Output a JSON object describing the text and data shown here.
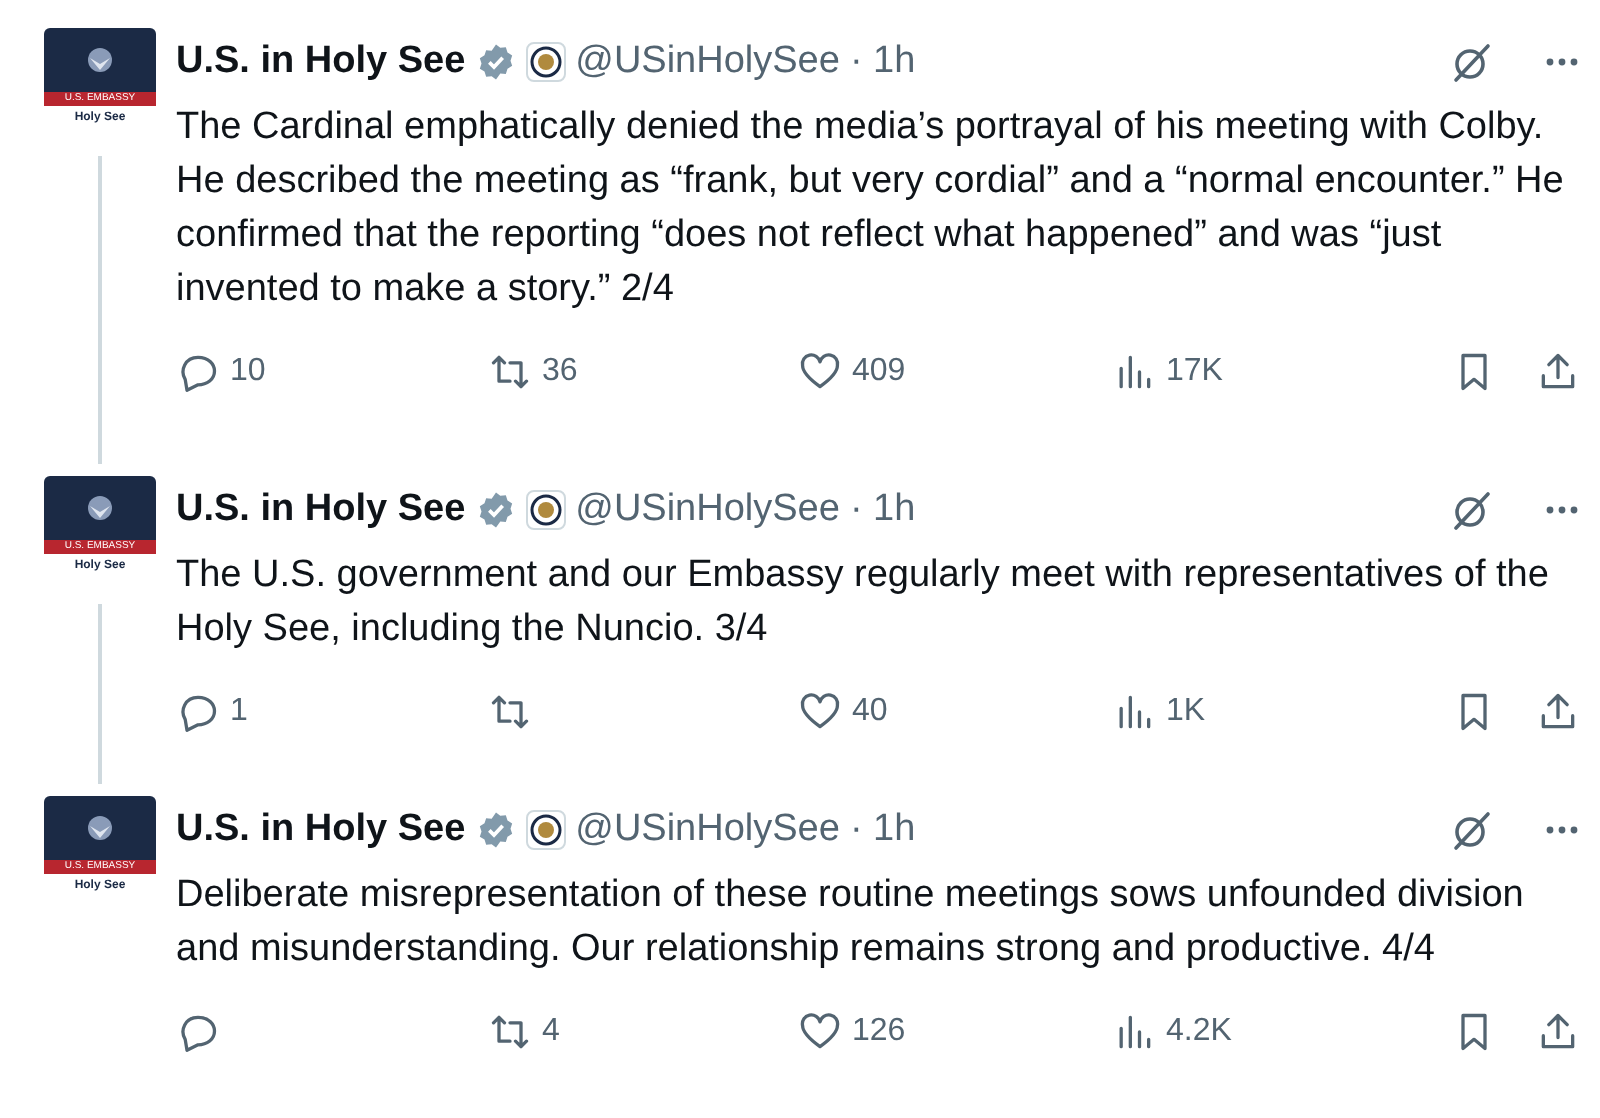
{
  "tweets": [
    {
      "avatar": {
        "banner": "U.S. EMBASSY",
        "caption": "Holy See"
      },
      "name": "U.S. in Holy See",
      "handle": "@USinHolySee",
      "time": "· 1h",
      "text": "The Cardinal emphatically denied the media’s portrayal of his meeting with Colby. He described the meeting as “frank, but very cordial” and a “normal encounter.”  He confirmed that the reporting “does not reflect what happened” and was “just invented to make a story.” 2/4",
      "replies": "10",
      "reposts": "36",
      "likes": "409",
      "views": "17K"
    },
    {
      "avatar": {
        "banner": "U.S. EMBASSY",
        "caption": "Holy See"
      },
      "name": "U.S. in Holy See",
      "handle": "@USinHolySee",
      "time": "· 1h",
      "text": "The U.S. government and our Embassy regularly meet with representatives of the Holy See, including the Nuncio. 3/4",
      "replies": "1",
      "likes": "40",
      "views": "1K"
    },
    {
      "avatar": {
        "banner": "U.S. EMBASSY",
        "caption": "Holy See"
      },
      "name": "U.S. in Holy See",
      "handle": "@USinHolySee",
      "time": "· 1h",
      "text": "Deliberate misrepresentation of these routine meetings sows unfounded division and misunderstanding.  Our relationship remains strong and productive. 4/4",
      "reposts": "4",
      "likes": "126",
      "views": "4.2K"
    }
  ]
}
